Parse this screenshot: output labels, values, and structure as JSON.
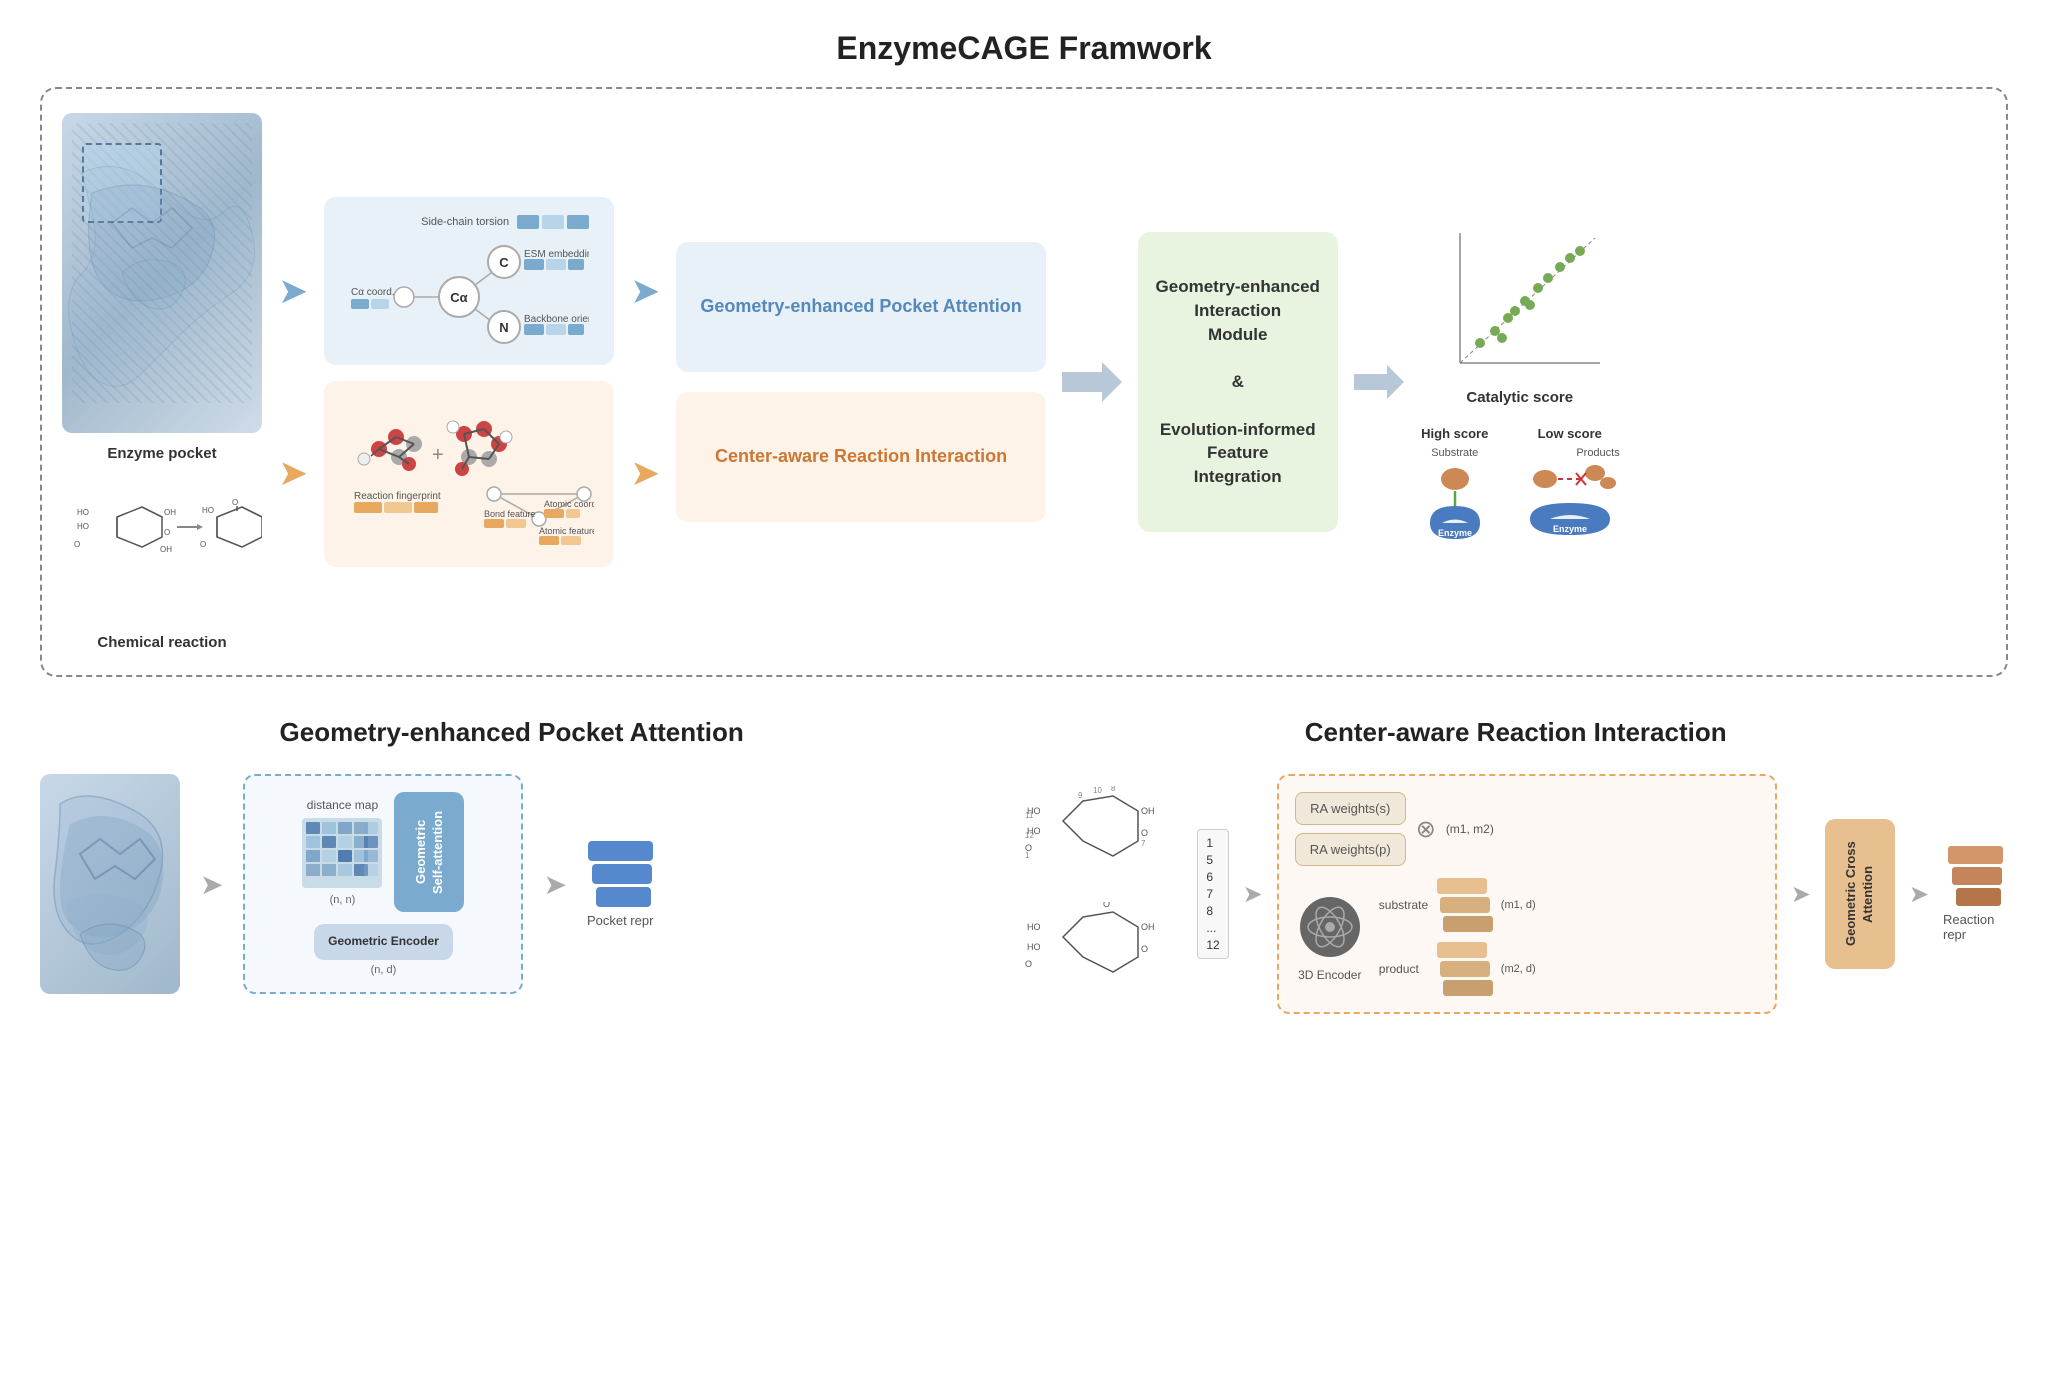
{
  "page": {
    "title": "EnzymeCAGE Framwork",
    "background": "#ffffff"
  },
  "framework": {
    "title": "EnzymeCAGE Framwork",
    "enzyme_pocket_label": "Enzyme pocket",
    "chemical_reaction_label": "Chemical reaction",
    "side_chain_torsion": "Side-chain torsion",
    "ca_coordinate": "Cα coordinate",
    "esm_embedding": "ESM embedding",
    "backbone_orientation": "Backbone orientation",
    "reaction_fingerprint": "Reaction fingerprint",
    "bond_feature": "Bond feature",
    "atomic_coordinate": "Atomic coordinate",
    "atomic_feature": "Atomic feature",
    "geometry_enhanced_pocket_attention": "Geometry-enhanced Pocket Attention",
    "center_aware_reaction_interaction": "Center-aware Reaction Interaction",
    "center_module_line1": "Geometry-enhanced",
    "center_module_line2": "Interaction",
    "center_module_line3": "Module",
    "center_module_and": "&",
    "center_module_line4": "Evolution-informed",
    "center_module_line5": "Feature",
    "center_module_line6": "Integration",
    "catalytic_score": "Catalytic score",
    "high_score": "High score",
    "low_score": "Low score",
    "substrate_label": "Substrate",
    "products_label": "Products",
    "enzyme_label1": "Enzyme",
    "enzyme_label2": "Enzyme",
    "node_ca": "Cα",
    "node_c": "C",
    "node_n": "N"
  },
  "geo_pocket": {
    "title": "Geometry-enhanced Pocket Attention",
    "distance_map_label": "distance map",
    "n_n_label": "(n, n)",
    "n_d_label": "(n, d)",
    "geo_encoder_label": "Geometric\nEncoder",
    "geo_self_attention_label": "Geometric\nSelf-attention",
    "pocket_repr_label": "Pocket repr"
  },
  "center_reaction": {
    "title": "Center-aware Reaction Interaction",
    "ra_weights_s": "RA weights(s)",
    "ra_weights_p": "RA weights(p)",
    "substrate_label": "substrate",
    "product_label": "product",
    "encoder_3d": "3D Encoder",
    "m1_m2_label": "(m1, m2)",
    "m1_d_label": "(m1, d)",
    "m2_d_label": "(m2, d)",
    "geo_cross_attention_label": "Geometric\nCross\nAttention",
    "reaction_repr_label": "Reaction repr"
  }
}
